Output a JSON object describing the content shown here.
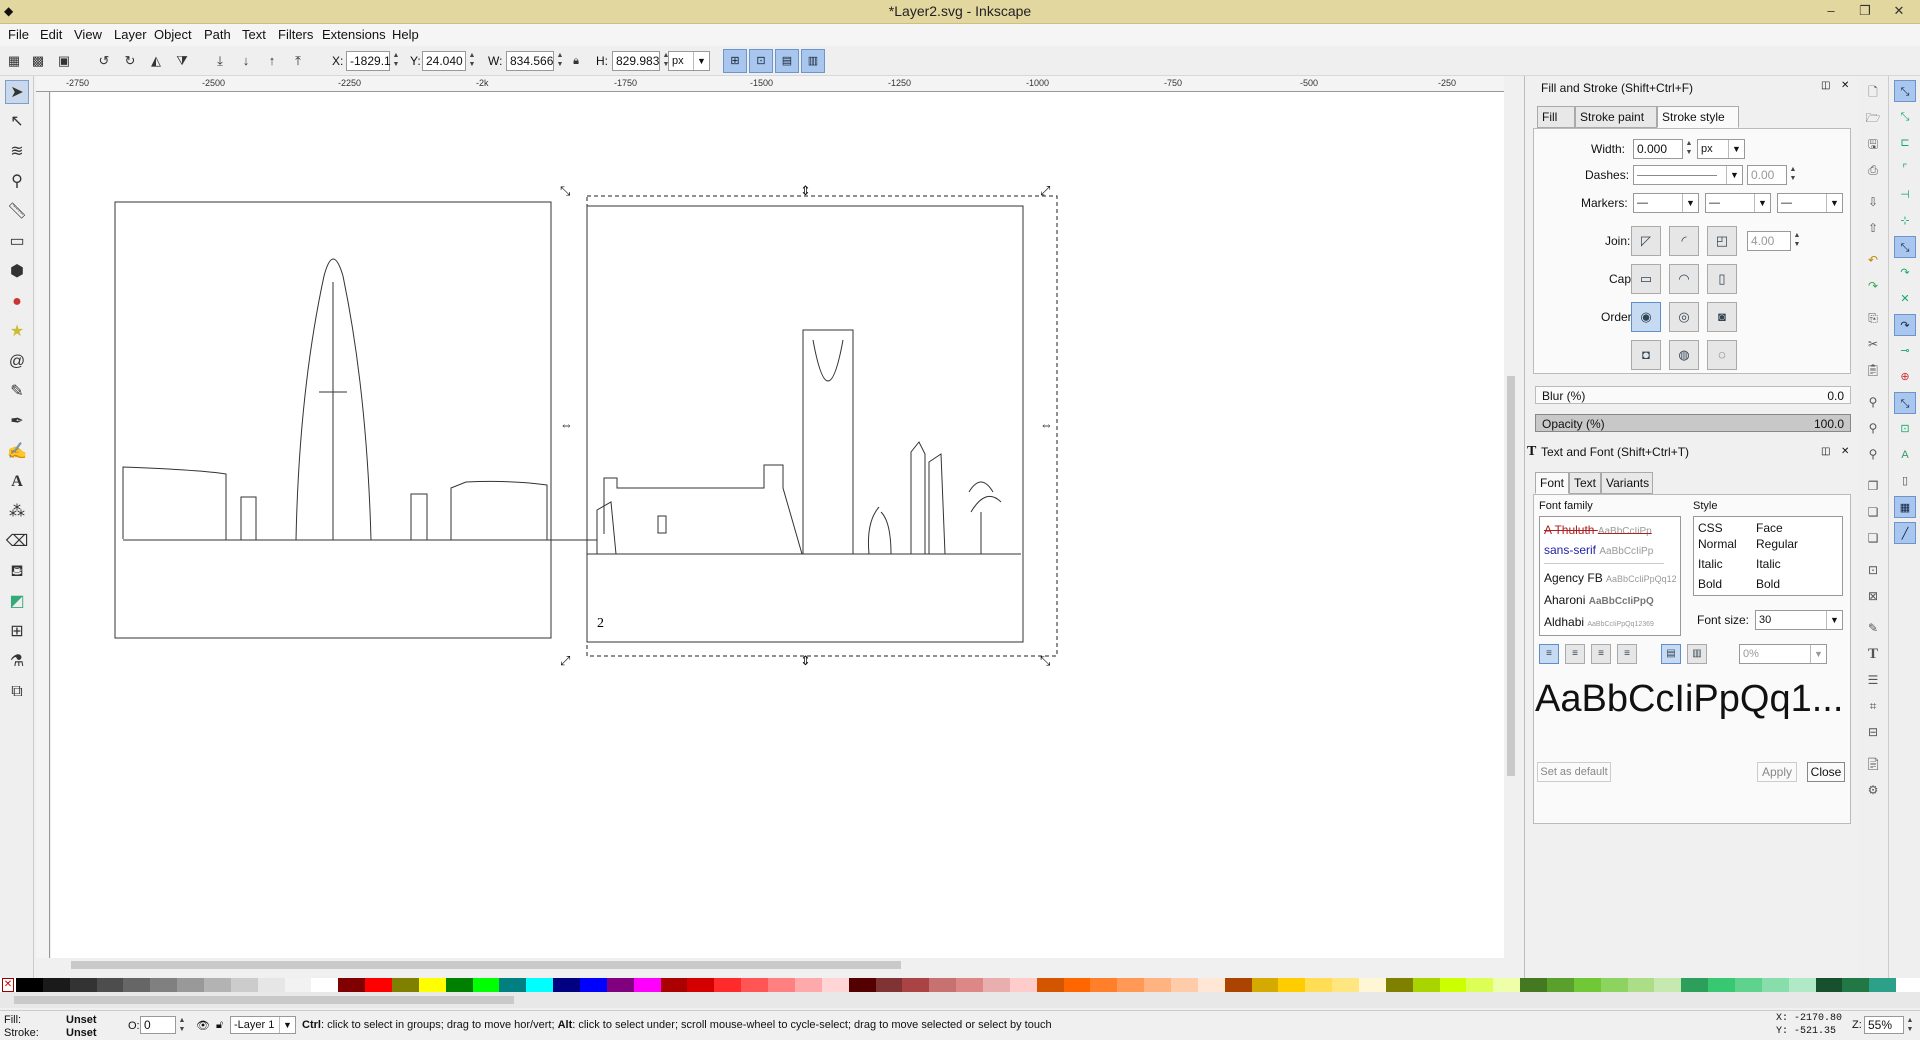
{
  "window": {
    "title": "*Layer2.svg - Inkscape",
    "min": "–",
    "max": "❐",
    "close": "✕"
  },
  "menu": [
    "File",
    "Edit",
    "View",
    "Layer",
    "Object",
    "Path",
    "Text",
    "Filters",
    "Extensions",
    "Help"
  ],
  "toolbar": {
    "x_label": "X:",
    "x_value": "-1829.1",
    "y_label": "Y:",
    "y_value": "24.040",
    "w_label": "W:",
    "w_value": "834.566",
    "h_label": "H:",
    "h_value": "829.983",
    "unit": "px"
  },
  "rulers": {
    "h_ticks": [
      "-2750",
      "-2500",
      "-2250",
      "-2k",
      "-1750",
      "-1500",
      "-1250",
      "-1000",
      "-750",
      "-500",
      "-250"
    ]
  },
  "canvas": {
    "page_number": "2"
  },
  "fill_stroke": {
    "title": "Fill and Stroke (Shift+Ctrl+F)",
    "tabs": [
      "Fill",
      "Stroke paint",
      "Stroke style"
    ],
    "width_label": "Width:",
    "width_value": "0.000",
    "width_unit": "px",
    "dashes_label": "Dashes:",
    "dashes_value": "0.00",
    "markers_label": "Markers:",
    "join_label": "Join:",
    "miter_value": "4.00",
    "cap_label": "Cap:",
    "order_label": "Order:",
    "blur_label": "Blur (%)",
    "blur_value": "0.0",
    "opacity_label": "Opacity (%)",
    "opacity_value": "100.0"
  },
  "text_font": {
    "title": "Text and Font (Shift+Ctrl+T)",
    "tabs": [
      "Font",
      "Text",
      "Variants"
    ],
    "family_label": "Font family",
    "families": [
      {
        "name": "A Thuluth",
        "sample": "AaBbCcIiPp",
        "strike": true
      },
      {
        "name": "sans-serif",
        "sample": "AaBbCcIiPp",
        "blue": true
      },
      {
        "name": "Agency FB",
        "sample": "AaBbCcIiPpQq12"
      },
      {
        "name": "Aharoni",
        "sample": "AaBbCcIiPpQ",
        "bold": true
      },
      {
        "name": "Aldhabi",
        "sample": "AaBbCcIiPpQq12369"
      }
    ],
    "style_label": "Style",
    "style_headers": [
      "CSS",
      "Face"
    ],
    "styles": [
      [
        "Normal",
        "Regular"
      ],
      [
        "Italic",
        "Italic"
      ],
      [
        "Bold",
        "Bold"
      ]
    ],
    "font_size_label": "Font size:",
    "font_size_value": "30",
    "spacing_value": "0%",
    "preview": "AaBbCcIiPpQq1...",
    "set_default": "Set as default",
    "apply": "Apply",
    "close": "Close"
  },
  "status": {
    "fill_label": "Fill:",
    "fill_value": "Unset",
    "stroke_label": "Stroke:",
    "stroke_value": "Unset",
    "opacity_label": "O:",
    "opacity_value": "0",
    "layer": "-Layer 1",
    "message_bold": "Ctrl",
    "message": ": click to select in groups; drag to move hor/vert; ",
    "message_bold2": "Alt",
    "message2": ": click to select under; scroll mouse-wheel to cycle-select; drag to move selected or select by touch",
    "x_coord": "X: -2170.80",
    "y_coord": "Y:  -521.35",
    "zoom_label": "Z:",
    "zoom_value": "55%"
  },
  "colors": {
    "titlebar": "#e3d7a0",
    "selected": "#a9c6ee",
    "palette": [
      "#000000",
      "#1a1a1a",
      "#333333",
      "#4d4d4d",
      "#666666",
      "#808080",
      "#999999",
      "#b3b3b3",
      "#cccccc",
      "#e6e6e6",
      "#f2f2f2",
      "#ffffff",
      "#800000",
      "#ff0000",
      "#808000",
      "#ffff00",
      "#008000",
      "#00ff00",
      "#008080",
      "#00ffff",
      "#000080",
      "#0000ff",
      "#800080",
      "#ff00ff",
      "#aa0000",
      "#d40000",
      "#ff2a2a",
      "#ff5555",
      "#ff8080",
      "#ffaaaa",
      "#ffd5d5",
      "#550000",
      "#803333",
      "#aa4444",
      "#c87171",
      "#de8787",
      "#e9afaf",
      "#ffcccc",
      "#d45500",
      "#ff6600",
      "#ff7f2a",
      "#ff9955",
      "#ffb380",
      "#ffccaa",
      "#ffe6d5",
      "#aa4400",
      "#d4aa00",
      "#ffcc00",
      "#ffdd55",
      "#ffe680",
      "#fff6d5",
      "#808000",
      "#aad400",
      "#ccff00",
      "#ddff55",
      "#eeffaa",
      "#447821",
      "#5aa02c",
      "#71c837",
      "#8dd35f",
      "#abde87",
      "#c6e9af",
      "#2ca05a",
      "#37c871",
      "#5fd38d",
      "#87deaa",
      "#afe9c6",
      "#16502d",
      "#217844",
      "#2ca089"
    ]
  }
}
